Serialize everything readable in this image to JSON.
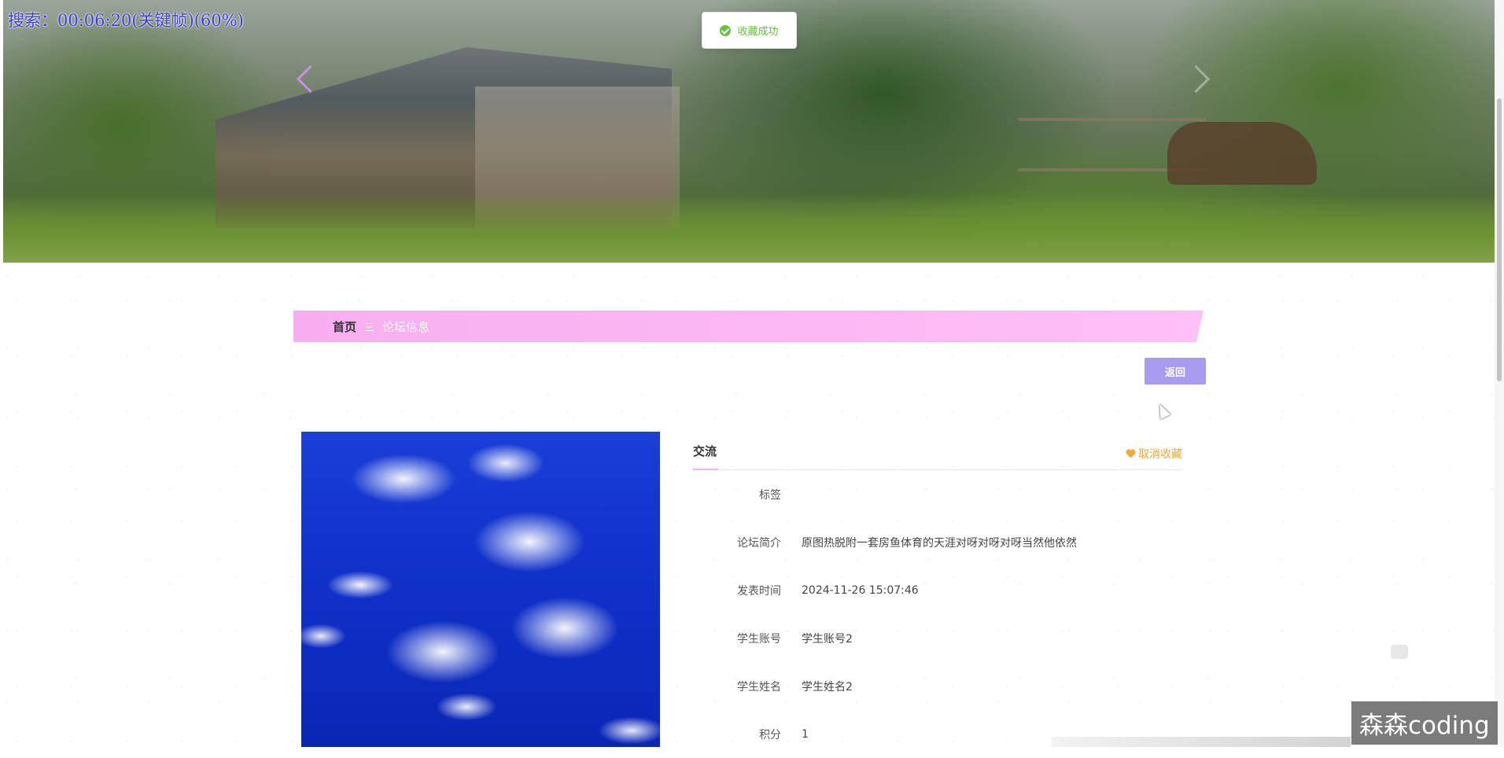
{
  "overlay": {
    "search_text": "搜索：00:06:20(关键帧)(60%)"
  },
  "toast": {
    "text": "收藏成功",
    "icon": "check-circle-icon",
    "color": "#67c23a"
  },
  "breadcrumb": {
    "home": "首页",
    "separator": "三",
    "current": "论坛信息"
  },
  "actions": {
    "back_label": "返回"
  },
  "detail": {
    "title": "交流",
    "favorite_label": "取消收藏",
    "favorite_icon": "heart-icon",
    "rows": [
      {
        "label": "标签",
        "value": ""
      },
      {
        "label": "论坛简介",
        "value": "原图热脱附一套房鱼体育的天涯对呀对呀对呀当然他依然"
      },
      {
        "label": "发表时间",
        "value": "2024-11-26 15:07:46"
      },
      {
        "label": "学生账号",
        "value": "学生账号2"
      },
      {
        "label": "学生姓名",
        "value": "学生姓名2"
      },
      {
        "label": "积分",
        "value": "1"
      }
    ]
  },
  "watermark": "森森coding",
  "colors": {
    "breadcrumb_bg": "#f7aef0",
    "back_button_bg": "#a99cf0",
    "favorite": "#f0a83c"
  }
}
